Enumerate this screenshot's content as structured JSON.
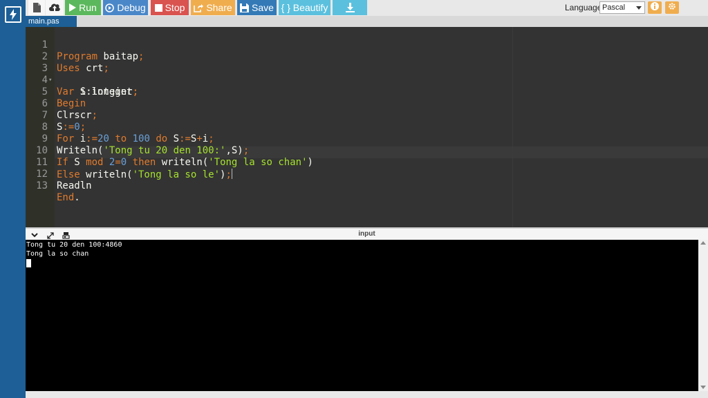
{
  "app": {
    "brand_icon": "bolt-icon"
  },
  "toolbar": {
    "file_icon": "file-icon",
    "upload_icon": "cloud-upload-icon",
    "run_label": "Run",
    "debug_label": "Debug",
    "stop_label": "Stop",
    "share_label": "Share",
    "save_label": "Save",
    "beautify_label": "{ } Beautify",
    "download_icon": "download-icon",
    "language_label": "Language",
    "language_value": "Pascal",
    "info_icon": "info-icon",
    "settings_icon": "gear-icon"
  },
  "tabs": [
    {
      "label": "main.pas"
    }
  ],
  "editor": {
    "line_numbers": [
      "1",
      "2",
      "3",
      "4",
      "5",
      "6",
      "7",
      "8",
      "9",
      "10",
      "11",
      "12",
      "13"
    ],
    "fold_marker_line": "3",
    "lines": [
      "Program baitap;",
      "Uses crt;",
      "Var i:integer;",
      "    S:longint;",
      "Begin",
      "Clrscr;",
      "S:=0;",
      "For i:=20 to 100 do S:=S+i;",
      "Writeln('Tong tu 20 den 100:',S);",
      "If S mod 2=0 then writeln('Tong la so chan')",
      "Else writeln('Tong la so le');",
      "Readln",
      "End."
    ]
  },
  "output": {
    "title": "input",
    "lines": [
      "Tong tu 20 den 100:4860",
      "Tong la so chan"
    ]
  },
  "colors": {
    "sidebar": "#1d5f96",
    "run": "#5cb85c",
    "debug": "#4a87c8",
    "stop": "#d9534f",
    "share": "#f0ad4e",
    "save": "#337ab7",
    "beautify": "#5bc0de",
    "keyword": "#e07b2d",
    "number": "#6aa0d8",
    "string": "#a6e22e"
  }
}
